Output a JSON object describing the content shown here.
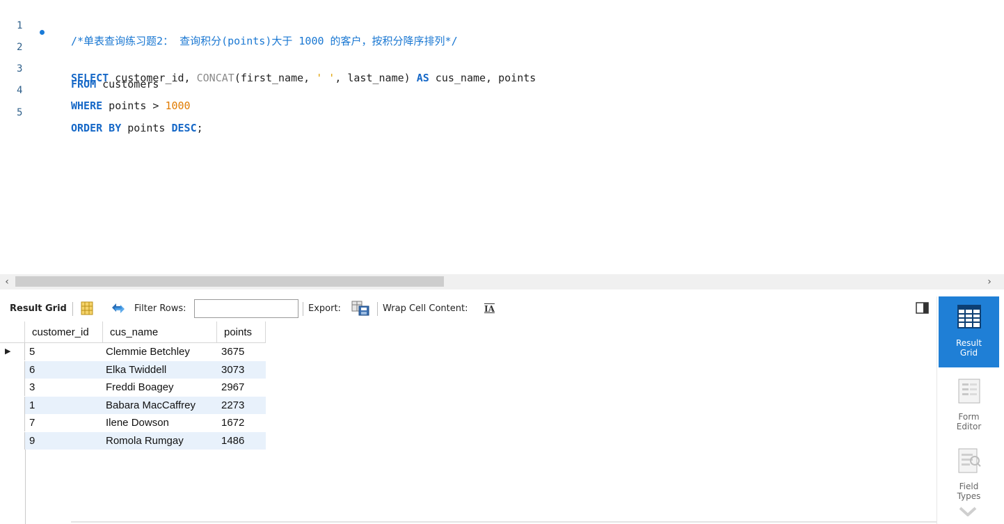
{
  "editor": {
    "line_numbers": [
      "1",
      "2",
      "3",
      "4",
      "5"
    ],
    "line1": "/*单表查询练习题2： 查询积分(points)大于 1000 的客户，按积分降序排列*/",
    "line2": {
      "select_kw": "SELECT",
      "part1": " customer_id, ",
      "concat_fn": "CONCAT",
      "part2": "(first_name, ",
      "str": "' '",
      "part3": ", last_name) ",
      "as_kw": "AS",
      "part4": " cus_name, points"
    },
    "line3": {
      "from_kw": "FROM",
      "table": " customers"
    },
    "line4": {
      "where_kw": "WHERE",
      "cond": " points > ",
      "num": "1000"
    },
    "line5": {
      "order_kw": "ORDER BY",
      "col": " points ",
      "desc_kw": "DESC",
      "end": ";"
    }
  },
  "scrollbar": {
    "left_arrow": "‹",
    "right_arrow": "›"
  },
  "toolbar": {
    "result_grid_label": "Result Grid",
    "filter_label": "Filter Rows:",
    "filter_value": "",
    "export_label": "Export:",
    "wrap_label": "Wrap Cell Content:",
    "wrap_icon_text": "IA"
  },
  "grid": {
    "columns": [
      "customer_id",
      "cus_name",
      "points"
    ],
    "rows": [
      {
        "customer_id": "5",
        "cus_name": "Clemmie Betchley",
        "points": "3675"
      },
      {
        "customer_id": "6",
        "cus_name": "Elka Twiddell",
        "points": "3073"
      },
      {
        "customer_id": "3",
        "cus_name": "Freddi Boagey",
        "points": "2967"
      },
      {
        "customer_id": "1",
        "cus_name": "Babara MacCaffrey",
        "points": "2273"
      },
      {
        "customer_id": "7",
        "cus_name": "Ilene Dowson",
        "points": "1672"
      },
      {
        "customer_id": "9",
        "cus_name": "Romola Rumgay",
        "points": "1486"
      }
    ],
    "selected_row_marker": "▶"
  },
  "side_panel": {
    "result_grid_line1": "Result",
    "result_grid_line2": "Grid",
    "form_editor_line1": "Form",
    "form_editor_line2": "Editor",
    "field_types_line1": "Field",
    "field_types_line2": "Types"
  },
  "colors": {
    "keyword": "#1668c7",
    "comment": "#1977d2",
    "number": "#e07b00",
    "active_side_tab": "#1f7fd6",
    "row_alt": "#e8f1fb"
  }
}
